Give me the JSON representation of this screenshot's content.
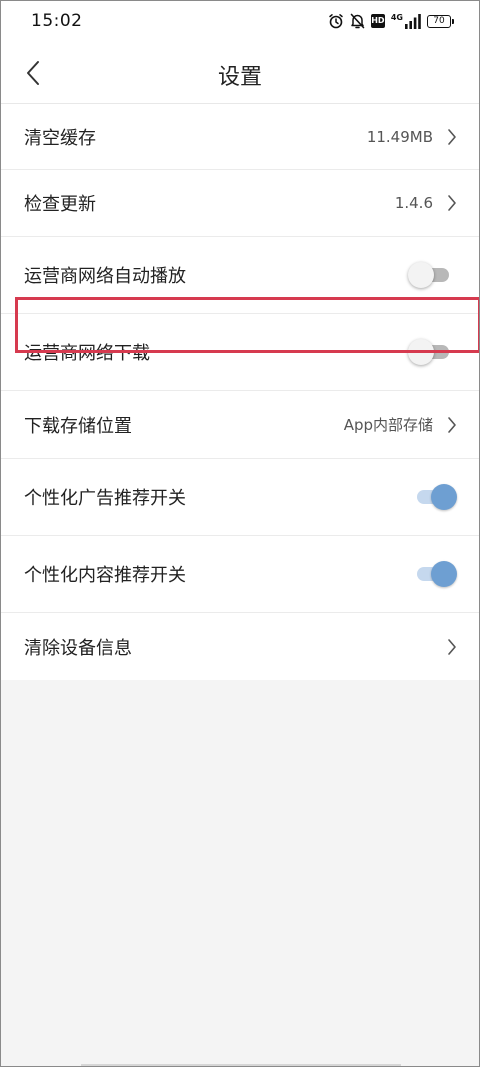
{
  "status_bar": {
    "time": "15:02",
    "icons": [
      "alarm-icon",
      "mute-bell-icon",
      "hd-icon",
      "signal-icon",
      "battery-icon"
    ],
    "hd_label": "HD",
    "network_label": "4G",
    "battery_level": "70"
  },
  "header": {
    "title": "设置",
    "back_icon": "chevron-left-icon"
  },
  "settings": {
    "items": [
      {
        "label": "清空缓存",
        "value": "11.49MB",
        "control": "chevron"
      },
      {
        "label": "检查更新",
        "value": "1.4.6",
        "control": "chevron"
      },
      {
        "label": "运营商网络自动播放",
        "control": "toggle",
        "enabled": false
      },
      {
        "label": "运营商网络下载",
        "control": "toggle",
        "enabled": false
      },
      {
        "label": "下载存储位置",
        "value": "App内部存储",
        "control": "chevron",
        "highlighted": true
      },
      {
        "label": "个性化广告推荐开关",
        "control": "toggle",
        "enabled": true
      },
      {
        "label": "个性化内容推荐开关",
        "control": "toggle",
        "enabled": true
      },
      {
        "label": "清除设备信息",
        "control": "chevron"
      }
    ]
  },
  "colors": {
    "accent": "#6e9fd2",
    "highlight": "#d63a4f",
    "background": "#f4f4f4"
  }
}
